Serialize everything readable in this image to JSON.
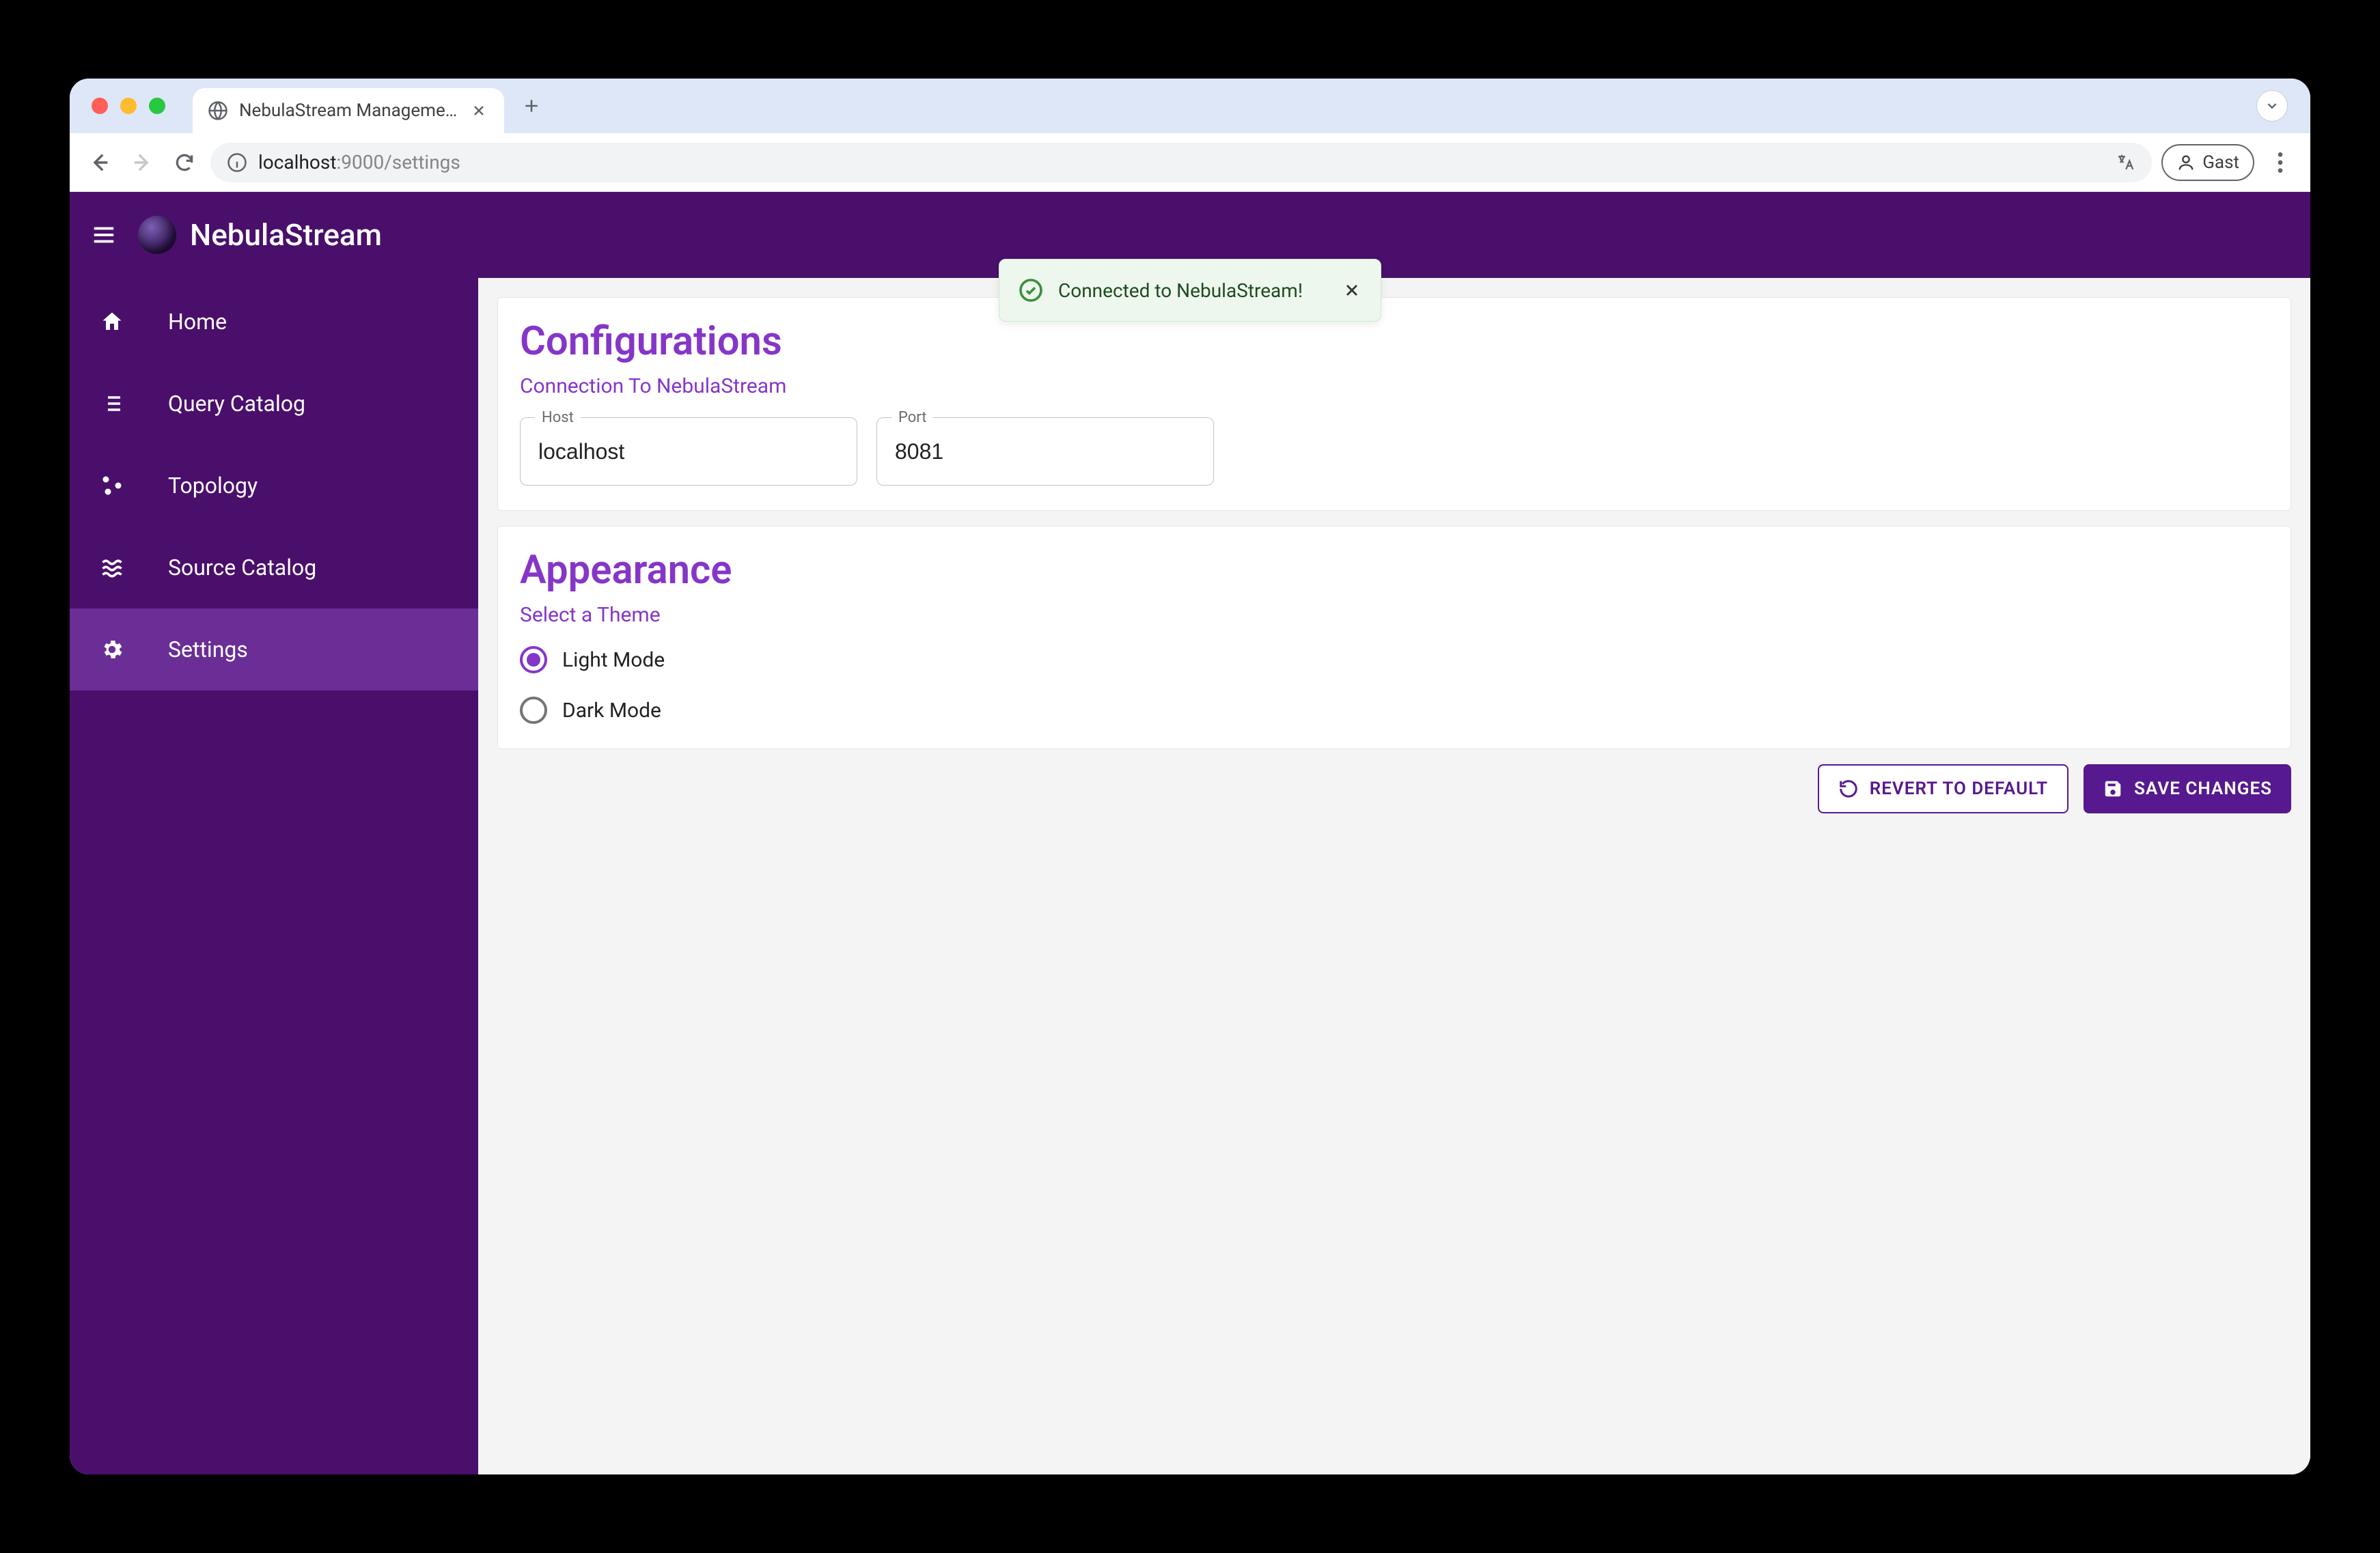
{
  "browser": {
    "tab_title": "NebulaStream Management U",
    "url_host": "localhost",
    "url_path": ":9000/settings",
    "guest_label": "Gast"
  },
  "header": {
    "brand_title": "NebulaStream"
  },
  "toast": {
    "message": "Connected to NebulaStream!"
  },
  "sidebar": {
    "items": [
      {
        "label": "Home"
      },
      {
        "label": "Query Catalog"
      },
      {
        "label": "Topology"
      },
      {
        "label": "Source Catalog"
      },
      {
        "label": "Settings"
      }
    ]
  },
  "configurations": {
    "title": "Configurations",
    "connection_label": "Connection To NebulaStream",
    "host_label": "Host",
    "host_value": "localhost",
    "port_label": "Port",
    "port_value": "8081"
  },
  "appearance": {
    "title": "Appearance",
    "select_theme_label": "Select a Theme",
    "options": [
      {
        "label": "Light Mode",
        "selected": true
      },
      {
        "label": "Dark Mode",
        "selected": false
      }
    ]
  },
  "actions": {
    "revert_label": "REVERT TO DEFAULT",
    "save_label": "SAVE CHANGES"
  }
}
